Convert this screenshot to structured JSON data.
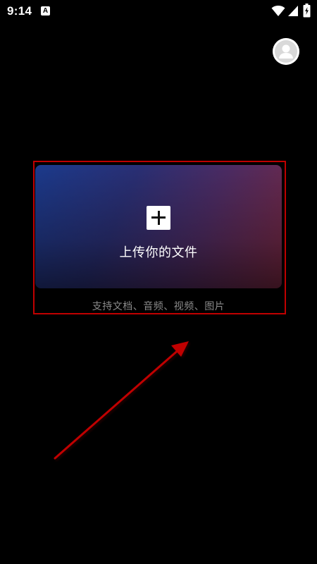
{
  "status_bar": {
    "time": "9:14",
    "notification_badge": "A",
    "icons": [
      "wifi-icon",
      "signal-icon",
      "battery-charging-icon"
    ]
  },
  "header": {
    "avatar_icon": "user-avatar-icon"
  },
  "upload_card": {
    "plus_icon": "plus-icon",
    "label": "上传你的文件",
    "support_text": "支持文档、音频、视频、图片"
  },
  "annotation": {
    "highlight_color": "#c00000",
    "arrow_color": "#c00000"
  },
  "colors": {
    "background": "#000000",
    "gradient_left": "#1b3a8c",
    "gradient_right": "#7a2841",
    "support_text": "#8a8a8a"
  }
}
